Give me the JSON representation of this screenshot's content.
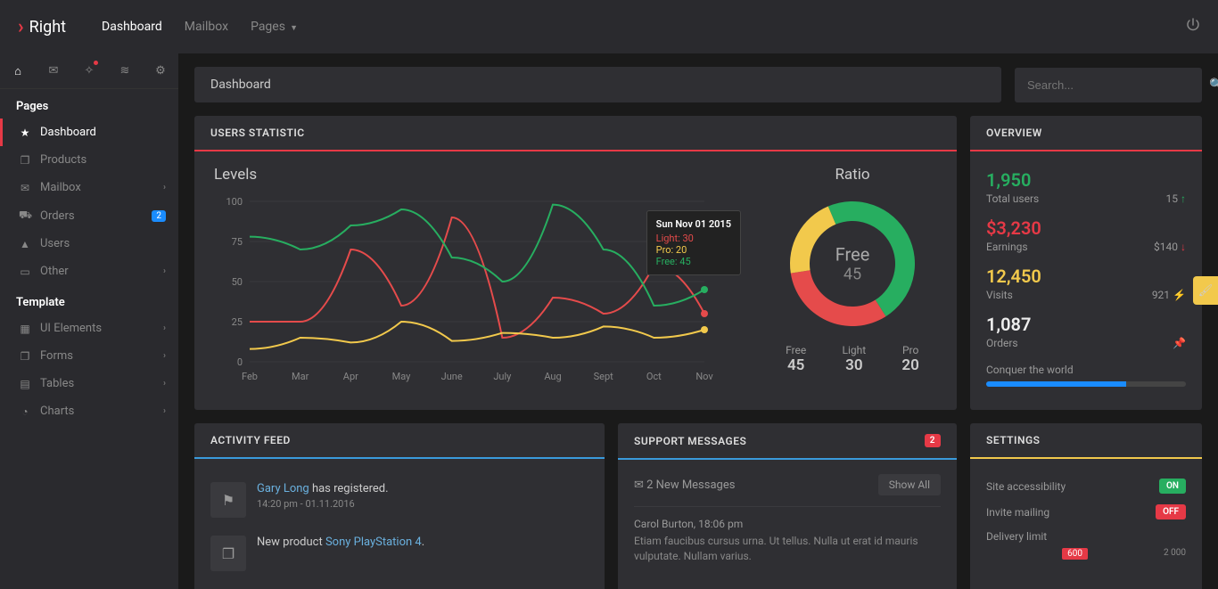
{
  "brand": "Right",
  "topnav": {
    "dashboard": "Dashboard",
    "mailbox": "Mailbox",
    "pages": "Pages"
  },
  "search": {
    "placeholder": "Search..."
  },
  "sidebar": {
    "section_pages": "Pages",
    "section_template": "Template",
    "items": {
      "dashboard": "Dashboard",
      "products": "Products",
      "mailbox": "Mailbox",
      "orders": "Orders",
      "orders_badge": "2",
      "users": "Users",
      "other": "Other",
      "ui_elements": "UI Elements",
      "forms": "Forms",
      "tables": "Tables",
      "charts": "Charts"
    }
  },
  "breadcrumb": "Dashboard",
  "stats": {
    "title": "USERS STATISTIC",
    "levels_title": "Levels",
    "ratio_title": "Ratio",
    "tooltip": {
      "date": "Sun Nov 01 2015",
      "light": "Light: 30",
      "pro": "Pro: 20",
      "free": "Free: 45"
    },
    "donut_center_label": "Free",
    "donut_center_val": "45",
    "legend": {
      "free_label": "Free",
      "free_val": "45",
      "light_label": "Light",
      "light_val": "30",
      "pro_label": "Pro",
      "pro_val": "20"
    }
  },
  "overview": {
    "title": "OVERVIEW",
    "total_users_val": "1,950",
    "total_users_label": "Total users",
    "total_users_right": "15",
    "earnings_val": "$3,230",
    "earnings_label": "Earnings",
    "earnings_right": "$140",
    "visits_val": "12,450",
    "visits_label": "Visits",
    "visits_right": "921",
    "orders_val": "1,087",
    "orders_label": "Orders",
    "progress_label": "Conquer the world"
  },
  "activity": {
    "title": "ACTIVITY FEED",
    "item1_user": "Gary Long",
    "item1_text": " has registered.",
    "item1_meta": "14:20 pm - 01.11.2016",
    "item2_prefix": "New product ",
    "item2_product": "Sony PlayStation 4"
  },
  "support": {
    "title": "SUPPORT MESSAGES",
    "badge": "2",
    "new_messages": "2 New Messages",
    "show_all": "Show All",
    "msg1_from": "Carol Burton, 18:06 pm",
    "msg1_text": "Etiam faucibus cursus urna. Ut tellus. Nulla ut erat id mauris vulputate. Nullam varius."
  },
  "settings": {
    "title": "SETTINGS",
    "site_accessibility": "Site accessibility",
    "on": "ON",
    "invite_mailing": "Invite mailing",
    "off": "OFF",
    "delivery_limit": "Delivery limit",
    "slider_val": "600",
    "slider_max": "2 000"
  },
  "chart_data": {
    "levels": {
      "type": "line",
      "categories": [
        "Feb",
        "Mar",
        "Apr",
        "May",
        "June",
        "July",
        "Aug",
        "Sept",
        "Oct",
        "Nov"
      ],
      "ylim": [
        0,
        100
      ],
      "yticks": [
        0,
        25,
        50,
        75,
        100
      ],
      "series": [
        {
          "name": "Light",
          "color": "#e54b4b",
          "values": [
            25,
            25,
            70,
            35,
            90,
            15,
            40,
            30,
            60,
            30
          ]
        },
        {
          "name": "Pro",
          "color": "#f2c94c",
          "values": [
            8,
            15,
            12,
            25,
            13,
            18,
            15,
            22,
            15,
            20
          ]
        },
        {
          "name": "Free",
          "color": "#27ae60",
          "values": [
            78,
            70,
            85,
            95,
            65,
            50,
            98,
            70,
            35,
            45
          ]
        }
      ]
    },
    "ratio": {
      "type": "pie",
      "series": [
        {
          "name": "Free",
          "value": 45,
          "color": "#27ae60"
        },
        {
          "name": "Light",
          "value": 30,
          "color": "#e54b4b"
        },
        {
          "name": "Pro",
          "value": 20,
          "color": "#f2c94c"
        }
      ]
    }
  }
}
